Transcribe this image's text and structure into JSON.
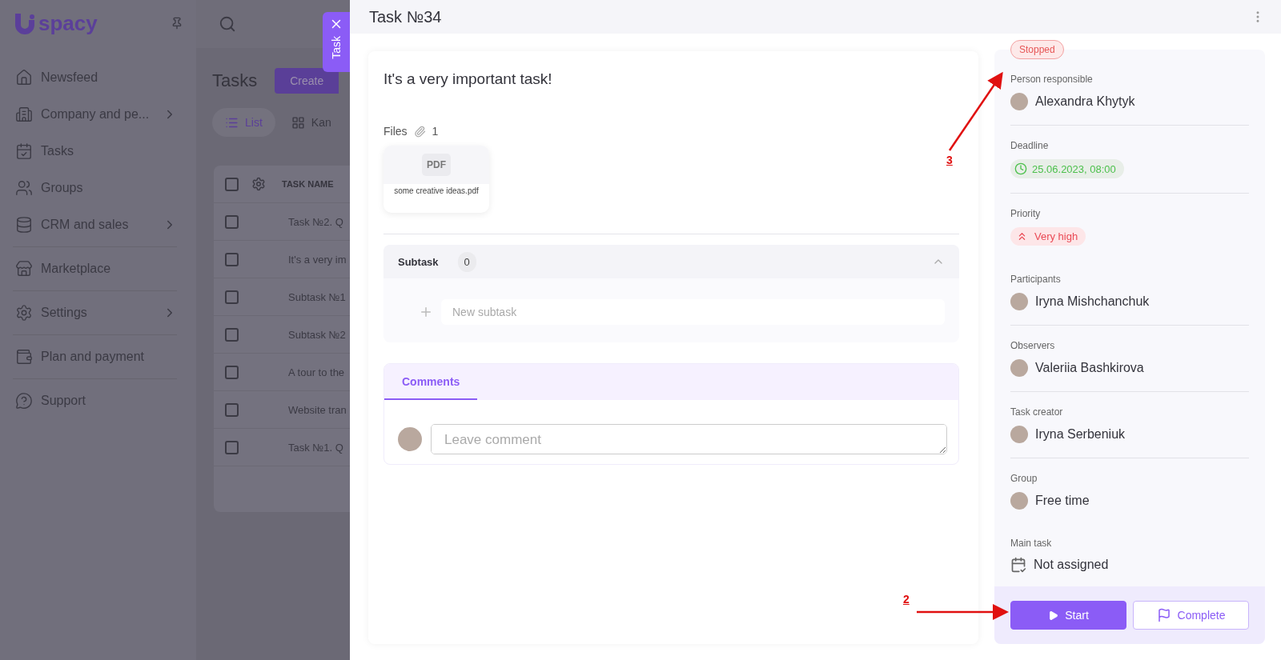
{
  "app": {
    "logo": "spacy"
  },
  "sidebar": {
    "groups": [
      {
        "items": [
          {
            "label": "Newsfeed",
            "submenu": false
          },
          {
            "label": "Company and pe...",
            "submenu": true
          },
          {
            "label": "Tasks",
            "submenu": false
          },
          {
            "label": "Groups",
            "submenu": false
          },
          {
            "label": "CRM and sales",
            "submenu": true
          }
        ]
      },
      {
        "items": [
          {
            "label": "Marketplace",
            "submenu": false
          }
        ]
      },
      {
        "items": [
          {
            "label": "Settings",
            "submenu": true
          }
        ]
      },
      {
        "items": [
          {
            "label": "Plan and payment",
            "submenu": false
          }
        ]
      },
      {
        "items": [
          {
            "label": "Support",
            "submenu": false
          }
        ]
      }
    ]
  },
  "tasks_page": {
    "title": "Tasks",
    "create_button": "Create",
    "view_tabs": [
      {
        "label": "List",
        "selected": true
      },
      {
        "label": "Kan",
        "selected": false
      }
    ],
    "table": {
      "select_all_checked": false,
      "columns": [
        "TASK NAME"
      ],
      "rows": [
        {
          "task_name": "Task №2. Q",
          "checked": false
        },
        {
          "task_name": "It's a very im",
          "checked": false
        },
        {
          "task_name": "Subtask №1",
          "checked": false
        },
        {
          "task_name": "Subtask №2",
          "checked": false
        },
        {
          "task_name": "A tour to the",
          "checked": false
        },
        {
          "task_name": "Website tran",
          "checked": false
        },
        {
          "task_name": "Task №1. Q",
          "checked": false
        }
      ]
    }
  },
  "drawer_tab": {
    "label": "Task"
  },
  "task": {
    "title": "Task №34",
    "description": "It's a very important task!",
    "files": {
      "label": "Files",
      "count": "1",
      "items": [
        {
          "type_label": "PDF",
          "name": "some creative ideas.pdf"
        }
      ]
    },
    "subtask": {
      "label": "Subtask",
      "count": "0",
      "expanded": true,
      "placeholder": "New subtask"
    },
    "comments": {
      "tabs": [
        {
          "label": "Comments",
          "selected": true
        }
      ],
      "placeholder": "Leave comment"
    }
  },
  "details": {
    "status": "Stopped",
    "fields": [
      {
        "kind": "person",
        "label": "Person responsible",
        "value": "Alexandra Khytyk"
      },
      {
        "kind": "date",
        "label": "Deadline",
        "value": "25.06.2023, 08:00"
      },
      {
        "kind": "priority",
        "label": "Priority",
        "value": "Very high"
      },
      {
        "kind": "person",
        "label": "Participants",
        "value": "Iryna Mishchanchuk"
      },
      {
        "kind": "person",
        "label": "Observers",
        "value": "Valeriia Bashkirova"
      },
      {
        "kind": "person",
        "label": "Task creator",
        "value": "Iryna Serbeniuk"
      },
      {
        "kind": "group",
        "label": "Group",
        "value": "Free time"
      },
      {
        "kind": "task",
        "label": "Main task",
        "value": "Not assigned"
      }
    ],
    "actions": [
      {
        "kind": "primary",
        "label": "Start"
      },
      {
        "kind": "secondary",
        "label": "Complete"
      }
    ]
  },
  "annotations": [
    {
      "label": "3"
    },
    {
      "label": "2"
    }
  ]
}
